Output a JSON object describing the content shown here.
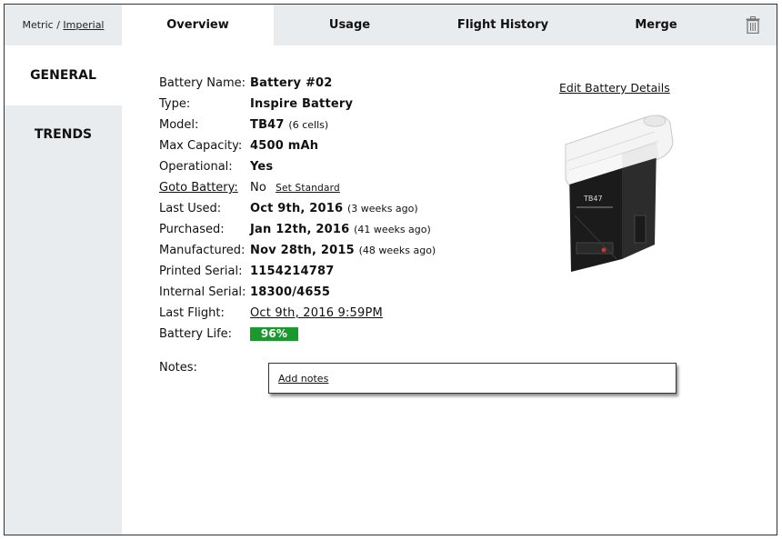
{
  "units": {
    "metric": "Metric",
    "separator": "/",
    "imperial": "Imperial"
  },
  "tabs": [
    {
      "label": "Overview",
      "active": true
    },
    {
      "label": "Usage"
    },
    {
      "label": "Flight History"
    },
    {
      "label": "Merge"
    }
  ],
  "sidebar": [
    {
      "label": "GENERAL",
      "active": true
    },
    {
      "label": "TRENDS"
    }
  ],
  "details": {
    "battery_name": {
      "label": "Battery Name:",
      "value": "Battery #02"
    },
    "type": {
      "label": "Type:",
      "value": "Inspire Battery"
    },
    "model": {
      "label": "Model:",
      "value": "TB47",
      "note": "(6 cells)"
    },
    "max_capacity": {
      "label": "Max Capacity:",
      "value": "4500 mAh"
    },
    "operational": {
      "label": "Operational:",
      "value": "Yes"
    },
    "goto_battery": {
      "label": "Goto Battery:",
      "value": "No",
      "action": "Set Standard"
    },
    "last_used": {
      "label": "Last Used:",
      "value": "Oct 9th, 2016",
      "note": "(3 weeks ago)"
    },
    "purchased": {
      "label": "Purchased:",
      "value": "Jan 12th, 2016",
      "note": "(41 weeks ago)"
    },
    "manufactured": {
      "label": "Manufactured:",
      "value": "Nov 28th, 2015",
      "note": "(48 weeks ago)"
    },
    "printed_serial": {
      "label": "Printed Serial:",
      "value": "1154214787"
    },
    "internal_serial": {
      "label": "Internal Serial:",
      "value": "18300/4655"
    },
    "last_flight": {
      "label": "Last Flight:",
      "value": "Oct 9th, 2016 9:59PM"
    },
    "battery_life": {
      "label": "Battery Life:",
      "value": "96%",
      "fraction": 0.96,
      "color": "#1a9a2e"
    }
  },
  "edit_link": "Edit Battery Details",
  "battery_image": {
    "text": "TB47",
    "icon": "battery-image"
  },
  "notes": {
    "label": "Notes:",
    "add_link": "Add notes"
  },
  "icons": {
    "trash": "trash-icon"
  }
}
